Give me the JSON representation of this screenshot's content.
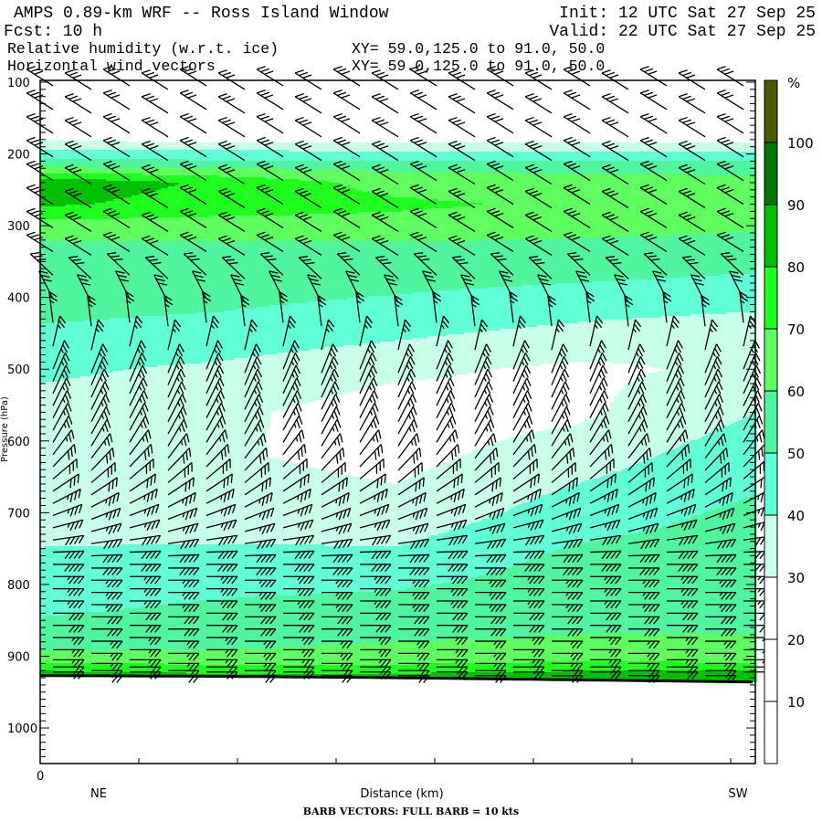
{
  "header": {
    "title": "AMPS 0.89-km WRF -- Ross Island Window",
    "init": "Init: 12 UTC Sat 27 Sep 25",
    "fcst": "Fcst:   10 h",
    "valid": "Valid: 22 UTC Sat 27 Sep 25",
    "field1": "Relative humidity (w.r.t. ice)",
    "field1_xy": "XY=  59.0,125.0 to  91.0, 50.0",
    "field2": "Horizontal wind vectors",
    "field2_xy": "XY=  59.0,125.0 to  91.0, 50.0"
  },
  "footer": {
    "barb_note": "BARB VECTORS:  FULL BARB = 10 kts"
  },
  "chart_data": {
    "type": "heatmap",
    "title": "Relative humidity (w.r.t. ice) cross-section with wind barbs",
    "xlabel": "Distance (km)",
    "x_start_label": "0",
    "x_left_label": "NE",
    "x_right_label": "SW",
    "ylabel": "Pressure (hPa)",
    "ylim": [
      97,
      1050
    ],
    "y_ticks": [
      "100",
      "200",
      "300",
      "400",
      "500",
      "600",
      "700",
      "800",
      "900",
      "1000"
    ],
    "colorbar": {
      "unit": "%",
      "tick_labels": [
        "10",
        "20",
        "30",
        "40",
        "50",
        "60",
        "70",
        "80",
        "90",
        "100"
      ],
      "bands": [
        {
          "min": 0,
          "max": 10,
          "color": "#ffffff"
        },
        {
          "min": 10,
          "max": 20,
          "color": "#ffffff"
        },
        {
          "min": 20,
          "max": 30,
          "color": "#ffffff"
        },
        {
          "min": 30,
          "max": 40,
          "color": "#c8ffe8"
        },
        {
          "min": 40,
          "max": 50,
          "color": "#60ffd8"
        },
        {
          "min": 50,
          "max": 60,
          "color": "#50f5a0"
        },
        {
          "min": 60,
          "max": 70,
          "color": "#60ff60"
        },
        {
          "min": 70,
          "max": 80,
          "color": "#1eff1e"
        },
        {
          "min": 80,
          "max": 90,
          "color": "#00c000"
        },
        {
          "min": 90,
          "max": 100,
          "color": "#007800"
        },
        {
          "min": 100,
          "max": 999,
          "color": "#4a5a00"
        }
      ]
    },
    "rh_field": {
      "x_positions": [
        0,
        0.25,
        0.5,
        0.75,
        1
      ],
      "pressure_levels": [
        100,
        175,
        190,
        205,
        220,
        240,
        270,
        300,
        330,
        380,
        420,
        460,
        500,
        560,
        620,
        700,
        760,
        820,
        870,
        900,
        915,
        930
      ],
      "values": [
        [
          15,
          22,
          38,
          48,
          62,
          88,
          82,
          65,
          58,
          55,
          52,
          47,
          42,
          36,
          33,
          36,
          41,
          47,
          53,
          63,
          75,
          88
        ],
        [
          15,
          22,
          37,
          47,
          60,
          78,
          75,
          66,
          58,
          54,
          50,
          45,
          38,
          32,
          31,
          35,
          42,
          50,
          55,
          62,
          72,
          85
        ],
        [
          15,
          22,
          35,
          46,
          58,
          66,
          72,
          66,
          58,
          52,
          47,
          40,
          32,
          25,
          27,
          33,
          42,
          52,
          58,
          64,
          72,
          85
        ],
        [
          15,
          22,
          35,
          46,
          58,
          64,
          68,
          64,
          57,
          50,
          43,
          35,
          28,
          28,
          35,
          45,
          52,
          56,
          60,
          65,
          75,
          88
        ],
        [
          15,
          22,
          36,
          46,
          58,
          62,
          65,
          62,
          55,
          48,
          40,
          30,
          32,
          40,
          46,
          52,
          55,
          57,
          60,
          63,
          75,
          90
        ]
      ],
      "ground_pressure": [
        927,
        928,
        930,
        933,
        936
      ]
    },
    "wind": {
      "columns": 19,
      "levels": [
        105,
        138,
        171,
        204,
        237,
        270,
        303,
        336,
        369,
        402,
        435,
        468,
        500,
        517,
        534,
        551,
        568,
        585,
        602,
        619,
        636,
        653,
        670,
        687,
        704,
        721,
        738,
        755,
        772,
        789,
        806,
        823,
        840,
        857,
        874,
        891,
        905,
        915,
        922
      ],
      "anchor_pressure": [
        100,
        350,
        480,
        600,
        760,
        930
      ],
      "anchor_speed_kts": [
        30,
        30,
        25,
        25,
        40,
        20
      ],
      "anchor_direction_deg": [
        -58,
        -58,
        20,
        30,
        90,
        90
      ]
    }
  }
}
